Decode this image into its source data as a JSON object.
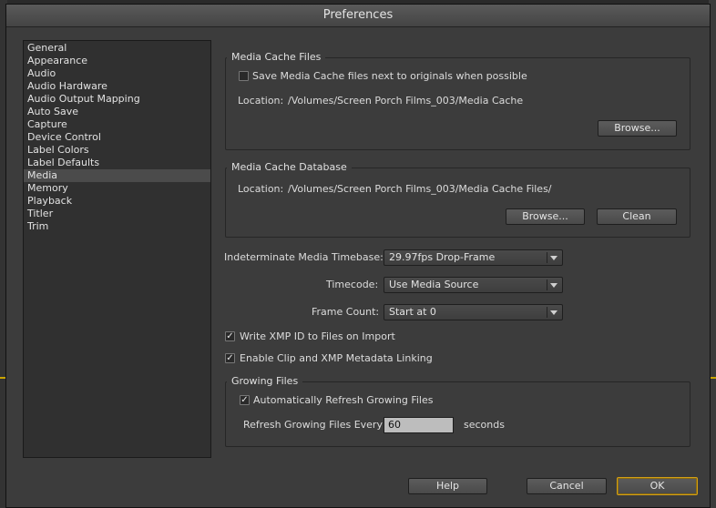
{
  "window": {
    "title": "Preferences"
  },
  "categories": [
    {
      "label": "General"
    },
    {
      "label": "Appearance"
    },
    {
      "label": "Audio"
    },
    {
      "label": "Audio Hardware"
    },
    {
      "label": "Audio Output Mapping"
    },
    {
      "label": "Auto Save"
    },
    {
      "label": "Capture"
    },
    {
      "label": "Device Control"
    },
    {
      "label": "Label Colors"
    },
    {
      "label": "Label Defaults"
    },
    {
      "label": "Media"
    },
    {
      "label": "Memory"
    },
    {
      "label": "Playback"
    },
    {
      "label": "Titler"
    },
    {
      "label": "Trim"
    }
  ],
  "selected_category": "Media",
  "media_cache_files": {
    "title": "Media Cache Files",
    "save_next_to_originals_label": "Save Media Cache files next to originals when possible",
    "save_next_to_originals_checked": false,
    "location_label": "Location:",
    "location_value": "/Volumes/Screen Porch Films_003/Media Cache",
    "browse_label": "Browse..."
  },
  "media_cache_database": {
    "title": "Media Cache Database",
    "location_label": "Location:",
    "location_value": "/Volumes/Screen Porch Films_003/Media Cache Files/",
    "browse_label": "Browse...",
    "clean_label": "Clean"
  },
  "settings": {
    "timebase_label": "Indeterminate Media Timebase:",
    "timebase_value": "29.97fps Drop-Frame",
    "timecode_label": "Timecode:",
    "timecode_value": "Use Media Source",
    "frame_count_label": "Frame Count:",
    "frame_count_value": "Start at 0",
    "write_xmp_label": "Write XMP ID to Files on Import",
    "write_xmp_checked": true,
    "enable_linking_label": "Enable Clip and XMP Metadata Linking",
    "enable_linking_checked": true
  },
  "growing_files": {
    "title": "Growing Files",
    "auto_refresh_label": "Automatically Refresh Growing Files",
    "auto_refresh_checked": true,
    "refresh_every_label": "Refresh Growing Files Every",
    "refresh_every_value": "60",
    "seconds_label": "seconds"
  },
  "footer": {
    "help_label": "Help",
    "cancel_label": "Cancel",
    "ok_label": "OK"
  },
  "glyphs": {
    "check": "✓"
  },
  "colors": {
    "accent": "#d4a015",
    "panel": "#3c3c3c",
    "list_selected": "#4b4b4b"
  }
}
